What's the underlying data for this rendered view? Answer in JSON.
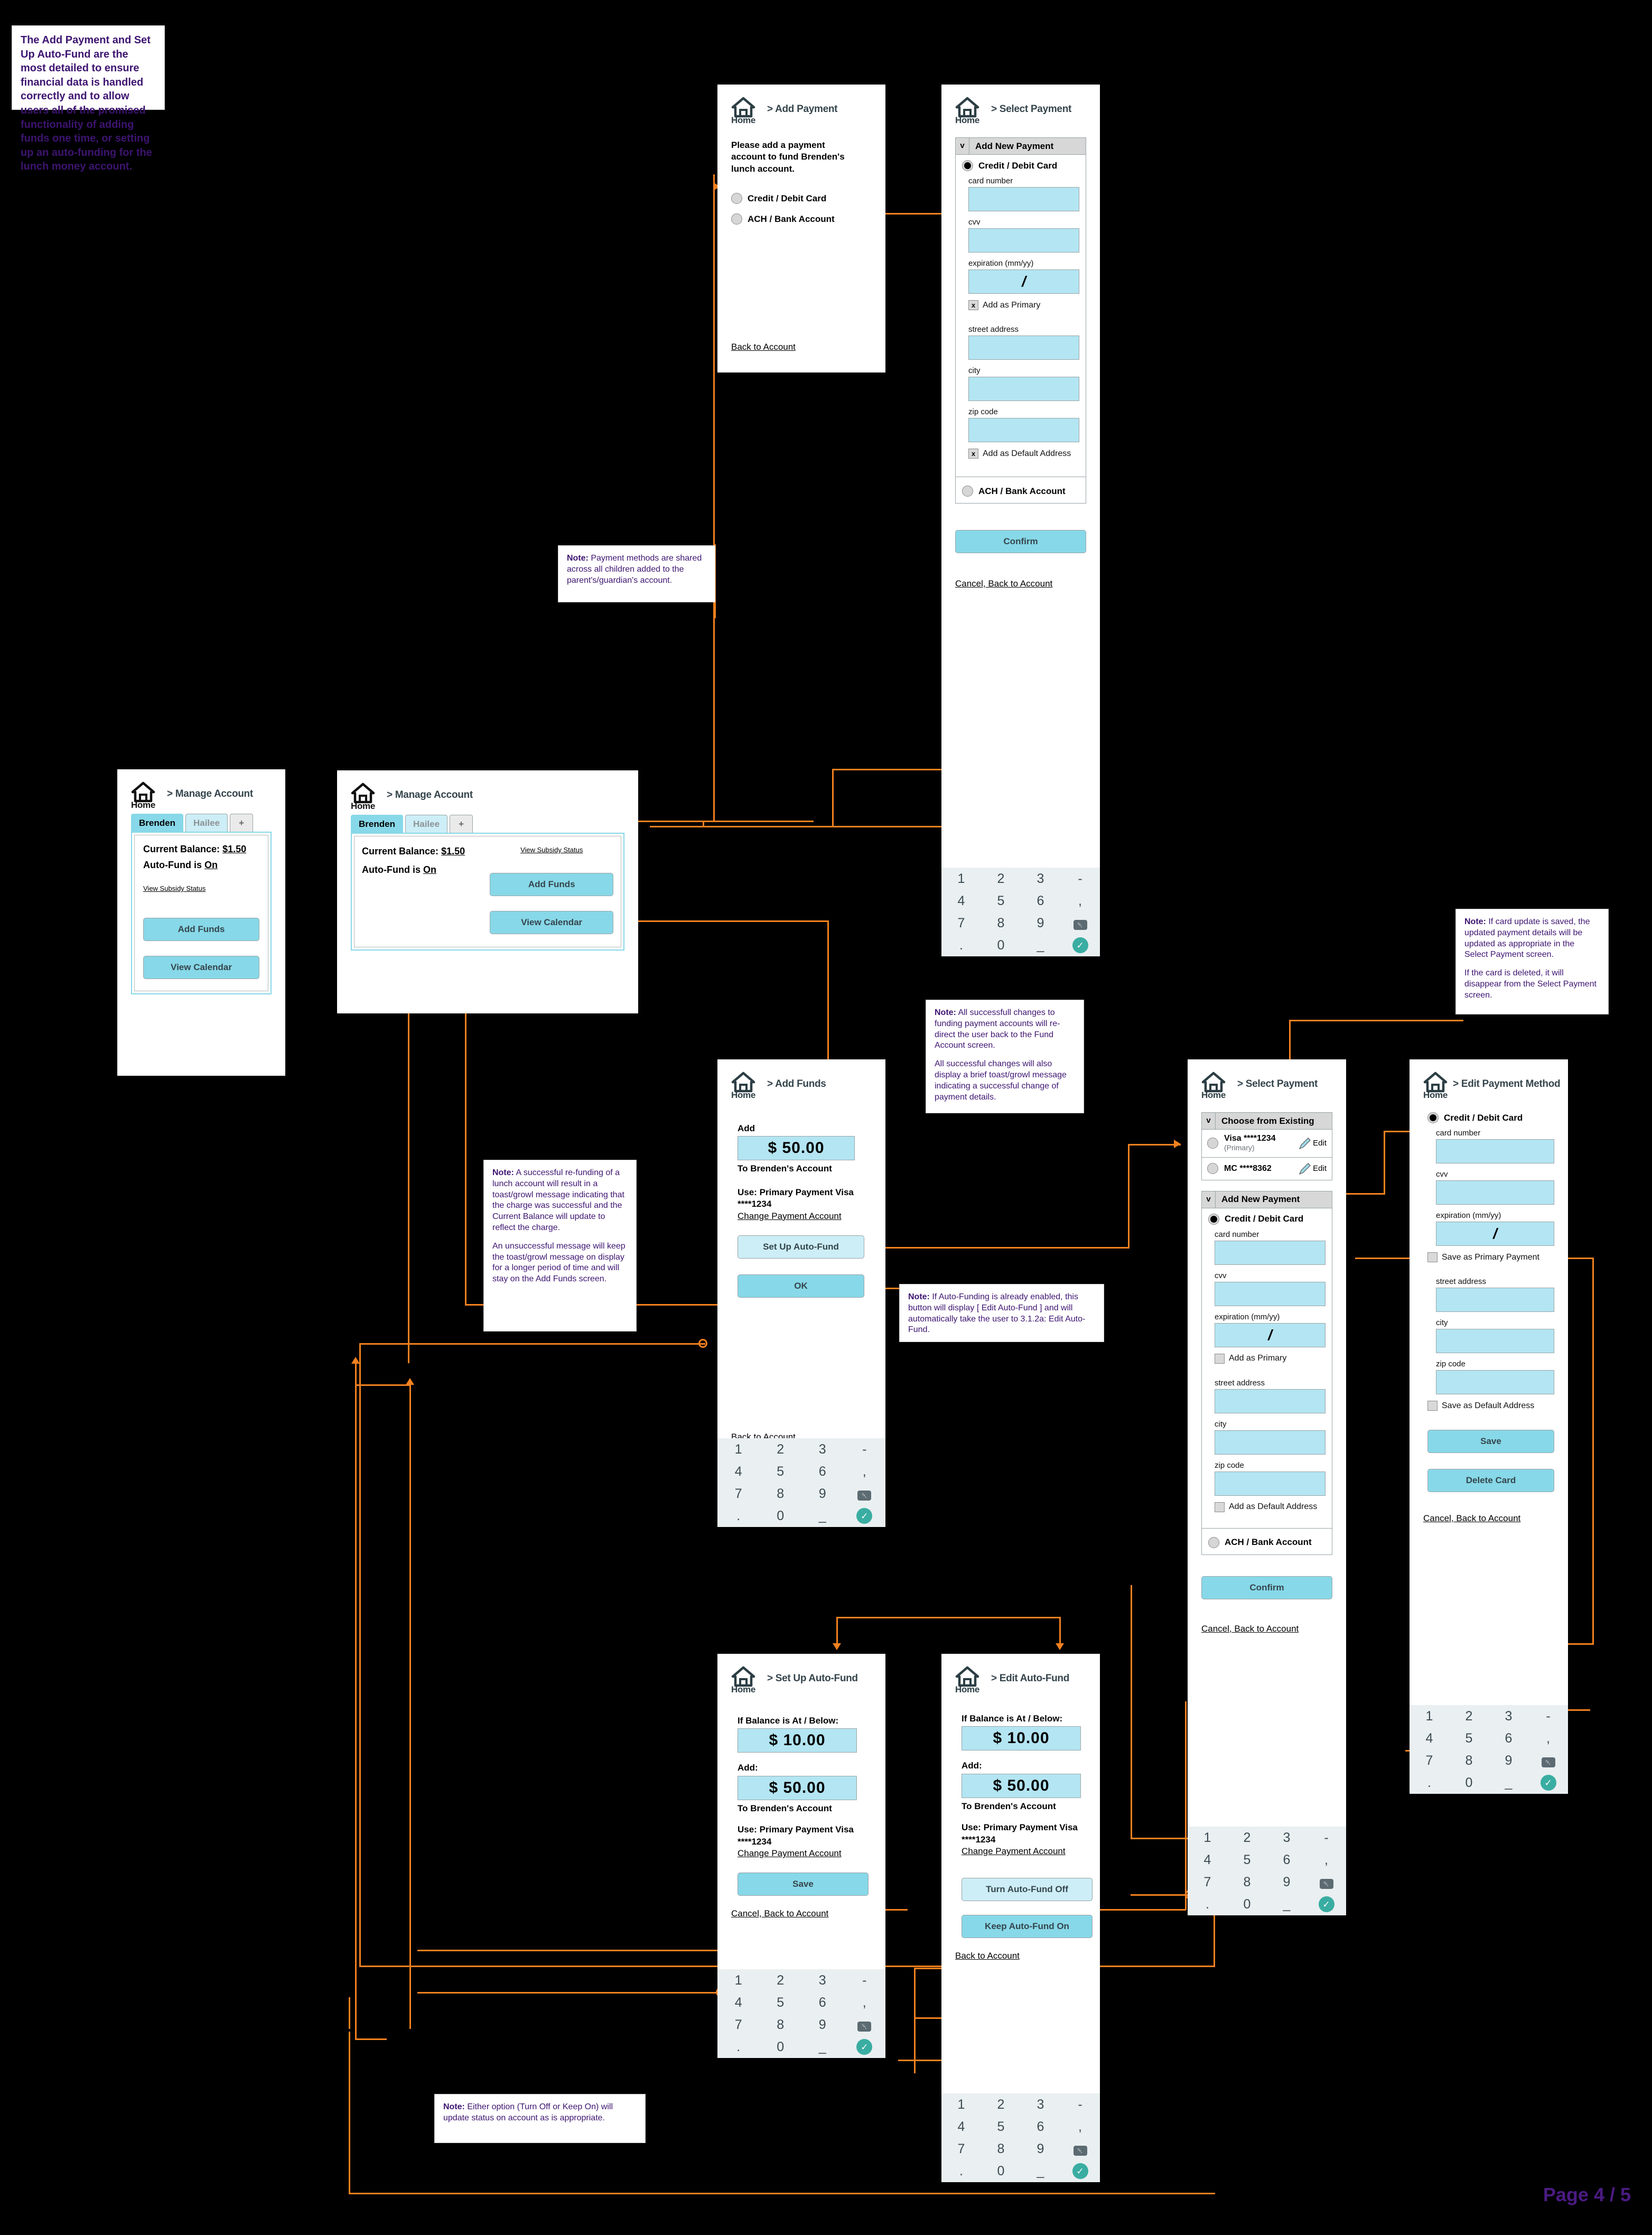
{
  "page": {
    "number_label": "Page 4 / 5"
  },
  "intro_note": {
    "text": "The Add Payment and Set Up Auto-Fund are the most detailed to ensure financial data is handled correctly and to allow users all of the promised functionality of adding funds one time, or setting up an auto-funding for the lunch money account."
  },
  "notes": {
    "payment_shared": "Payment methods are shared across all children added to the parent's/guardian's account.",
    "refunding_p1": "A successful re-funding of a lunch account will result in a toast/growl message indicating that the charge was successful and the Current Balance will update to reflect the charge.",
    "refunding_p2": "An unsuccessful message will keep the toast/growl message on display for a longer period of time and will stay on the Add Funds screen.",
    "changes_p1": "All successfull changes to funding payment accounts will re-direct the user back to the Fund Account screen.",
    "changes_p2": "All successful changes will also display a brief toast/growl message indicating a successful change of payment details.",
    "autofund_enabled": "If Auto-Funding is already enabled, this button will display [ Edit Auto-Fund ] and will automatically take the user to 3.1.2a: Edit Auto-Fund.",
    "card_update_p1": "If card update is saved, the updated payment details will be updated as appropriate in the Select Payment screen.",
    "card_update_p2": "If the card is deleted, it will disappear from the Select Payment screen.",
    "turnoff_keepon": "Either option (Turn Off or Keep On) will update status on account as is appropriate.",
    "label": "Note:"
  },
  "common": {
    "home_label": "Home",
    "back_to_account": "Back to Account",
    "cancel_back_to_account": "Cancel, Back to Account",
    "change_payment_account": "Change Payment Account",
    "to_brendens_account": "To Brenden's Account",
    "use_primary_payment": "Use: Primary Payment Visa ****1234",
    "credit_debit_card": "Credit / Debit Card",
    "ach_bank_account": "ACH / Bank Account",
    "card_number": "card number",
    "cvv": "cvv",
    "expiration": "expiration (mm/yy)",
    "expiration_value": "/",
    "street_address": "street address",
    "city": "city",
    "zip_code": "zip code",
    "add_as_primary": "Add as Primary",
    "add_as_default_address": "Add as Default Address",
    "checkbox_mark": "x",
    "chevron": "v",
    "edit_label": "Edit"
  },
  "keypad": {
    "keys": [
      "1",
      "2",
      "3",
      "-",
      "4",
      "5",
      "6",
      ",",
      "7",
      "8",
      "9",
      "del",
      ".",
      "0",
      "_",
      "ok"
    ]
  },
  "screens": {
    "add_payment": {
      "breadcrumb": "> Add Payment",
      "prompt": "Please add a payment account to fund Brenden's lunch account.",
      "options": [
        "Credit / Debit Card",
        "ACH / Bank Account"
      ],
      "footer_link": "Back to Account"
    },
    "select_payment_new": {
      "breadcrumb": "> Select Payment",
      "accordion_title": "Add New Payment",
      "confirm_label": "Confirm",
      "cancel_link": "Cancel, Back to Account"
    },
    "manage_account_narrow": {
      "breadcrumb": "> Manage Account",
      "tabs": [
        "Brenden",
        "Hailee",
        "+"
      ],
      "balance_label": "Current Balance:",
      "balance_value": "$1.50",
      "autofund_label": "Auto-Fund is",
      "autofund_value": "On",
      "subsidy_link": "View Subsidy Status",
      "buttons": [
        "Add Funds",
        "View Calendar"
      ]
    },
    "manage_account_wide": {
      "breadcrumb": "> Manage Account",
      "tabs": [
        "Brenden",
        "Hailee",
        "+"
      ],
      "balance_label": "Current Balance:",
      "balance_value": "$1.50",
      "autofund_label": "Auto-Fund is",
      "autofund_value": "On",
      "subsidy_link": "View Subsidy Status",
      "buttons": [
        "Add Funds",
        "View Calendar"
      ]
    },
    "add_funds": {
      "breadcrumb": "> Add Funds",
      "add_label": "Add",
      "amount": "$ 50.00",
      "to_account": "To Brenden's Account",
      "use_line": "Use: Primary Payment Visa ****1234",
      "change_link": "Change Payment Account",
      "autofund_button": "Set Up Auto-Fund",
      "ok_button": "OK",
      "footer_link": "Back to Account"
    },
    "select_payment_existing": {
      "breadcrumb": "> Select Payment",
      "existing_title": "Choose from Existing",
      "cards": [
        {
          "name": "Visa ****1234",
          "sub": "(Primary)",
          "edit": "Edit"
        },
        {
          "name": "MC ****8362",
          "sub": "",
          "edit": "Edit"
        }
      ],
      "new_title": "Add New Payment",
      "confirm_label": "Confirm",
      "cancel_link": "Cancel, Back to Account"
    },
    "edit_payment_method": {
      "breadcrumb": "> Edit Payment Method",
      "radio_label": "Credit / Debit Card",
      "save_primary": "Save as Primary Payment",
      "save_default_address": "Save as Default Address",
      "save_button": "Save",
      "delete_button": "Delete Card",
      "cancel_link": "Cancel, Back to Account"
    },
    "setup_autofund": {
      "breadcrumb": "> Set Up Auto-Fund",
      "threshold_label": "If Balance is At / Below:",
      "threshold_value": "$ 10.00",
      "add_label": "Add:",
      "add_value": "$ 50.00",
      "to_account": "To Brenden's Account",
      "use_line": "Use: Primary Payment Visa ****1234",
      "change_link": "Change Payment Account",
      "save_button": "Save",
      "cancel_link": "Cancel, Back to Account"
    },
    "edit_autofund": {
      "breadcrumb": "> Edit Auto-Fund",
      "threshold_label": "If Balance is At / Below:",
      "threshold_value": "$ 10.00",
      "add_label": "Add:",
      "add_value": "$ 50.00",
      "to_account": "To Brenden's Account",
      "use_line": "Use: Primary Payment Visa ****1234",
      "change_link": "Change Payment Account",
      "turn_off_button": "Turn Auto-Fund Off",
      "keep_on_button": "Keep Auto-Fund On",
      "footer_link": "Back to Account"
    }
  },
  "colors": {
    "accent": "#87d8e8",
    "flow": "#f3811f",
    "note_text": "#3d1470",
    "field": "#b3e5f2"
  }
}
